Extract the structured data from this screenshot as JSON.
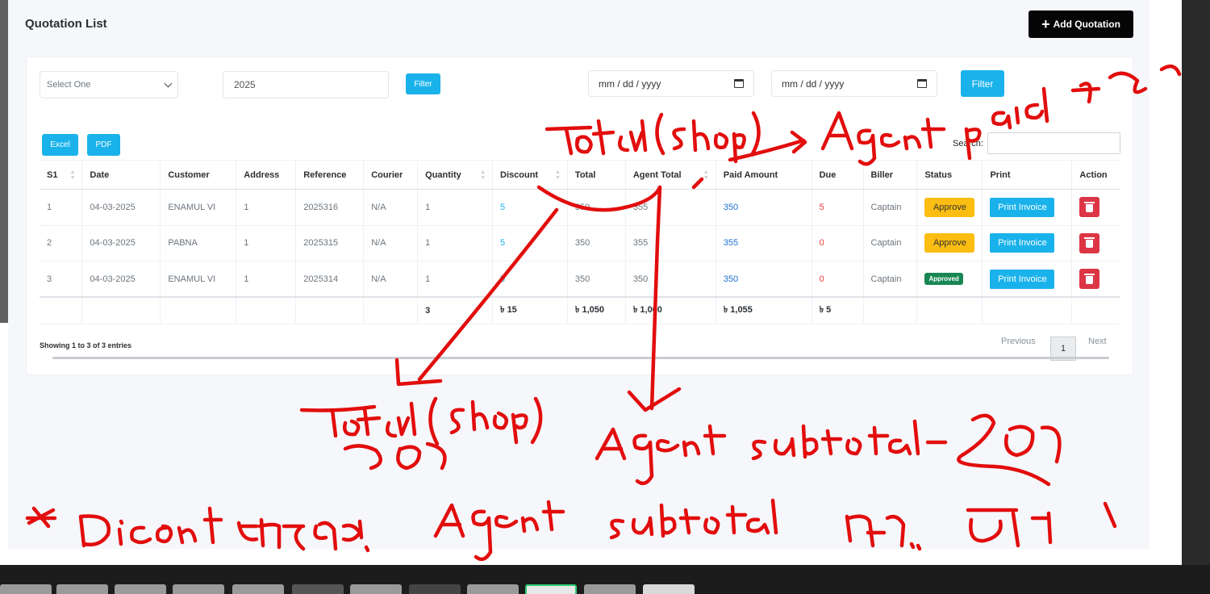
{
  "header": {
    "title": "Quotation List",
    "add_button": "Add Quotation"
  },
  "filters": {
    "select_placeholder": "Select One",
    "year_value": "2025",
    "filter_small": "Filter",
    "date_from": "mm / dd / yyyy",
    "date_to": "mm / dd / yyyy",
    "filter_large": "Filter"
  },
  "toolbar": {
    "excel": "Excel",
    "pdf": "PDF",
    "search_label": "Search:"
  },
  "table": {
    "columns": [
      "S1",
      "Date",
      "Customer",
      "Address",
      "Reference",
      "Courier",
      "Quantity",
      "Discount",
      "Total",
      "Agent Total",
      "Paid Amount",
      "Due",
      "Biller",
      "Status",
      "Print",
      "Action"
    ],
    "rows": [
      {
        "sl": "1",
        "date": "04-03-2025",
        "customer": "ENAMUL VI",
        "address": "1",
        "reference": "2025316",
        "courier": "N/A",
        "quantity": "1",
        "discount": "5",
        "total": "350",
        "agent_total": "355",
        "paid": "350",
        "due": "5",
        "biller": "Captain",
        "status": "Approve",
        "print": "Print Invoice"
      },
      {
        "sl": "2",
        "date": "04-03-2025",
        "customer": "PABNA",
        "address": "1",
        "reference": "2025315",
        "courier": "N/A",
        "quantity": "1",
        "discount": "5",
        "total": "350",
        "agent_total": "355",
        "paid": "355",
        "due": "0",
        "biller": "Captain",
        "status": "Approve",
        "print": "Print Invoice"
      },
      {
        "sl": "3",
        "date": "04-03-2025",
        "customer": "ENAMUL VI",
        "address": "1",
        "reference": "2025314",
        "courier": "N/A",
        "quantity": "1",
        "discount": "5",
        "total": "350",
        "agent_total": "350",
        "paid": "350",
        "due": "0",
        "biller": "Captain",
        "status": "Approved",
        "print": "Print Invoice"
      }
    ],
    "totals": {
      "quantity": "3",
      "discount": "৳ 15",
      "total": "৳ 1,050",
      "agent_total": "৳ 1,060",
      "paid": "৳ 1,055",
      "due": "৳ 5"
    }
  },
  "footer": {
    "showing": "Showing 1 to 3 of 3 entries",
    "previous": "Previous",
    "current_page": "1",
    "next": "Next"
  },
  "annotation": {
    "color": "#e20d0d"
  }
}
